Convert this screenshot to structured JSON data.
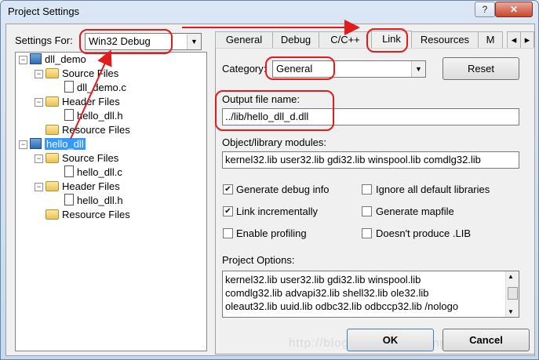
{
  "window": {
    "title": "Project Settings",
    "help_label": "?",
    "close_label": "✕"
  },
  "settings_for": {
    "label": "Settings For:",
    "value": "Win32 Debug"
  },
  "tree": {
    "nodes": [
      {
        "label": "dll_demo"
      },
      {
        "label": "Source Files"
      },
      {
        "label": "dll_demo.c"
      },
      {
        "label": "Header Files"
      },
      {
        "label": "hello_dll.h"
      },
      {
        "label": "Resource Files"
      },
      {
        "label": "hello_dll"
      },
      {
        "label": "Source Files"
      },
      {
        "label": "hello_dll.c"
      },
      {
        "label": "Header Files"
      },
      {
        "label": "hello_dll.h"
      },
      {
        "label": "Resource Files"
      }
    ]
  },
  "tabs": [
    {
      "label": "General"
    },
    {
      "label": "Debug"
    },
    {
      "label": "C/C++"
    },
    {
      "label": "Link"
    },
    {
      "label": "Resources"
    },
    {
      "label": "M"
    }
  ],
  "tab_scroll": {
    "left": "◂",
    "right": "▸"
  },
  "link": {
    "category_label": "Category:",
    "category_value": "General",
    "reset_label": "Reset",
    "output_label": "Output file name:",
    "output_value": "../lib/hello_dll_d.dll",
    "modules_label": "Object/library modules:",
    "modules_value": "kernel32.lib user32.lib gdi32.lib winspool.lib comdlg32.lib",
    "options": [
      {
        "label": "Generate debug info",
        "checked": true
      },
      {
        "label": "Ignore all default libraries",
        "checked": false
      },
      {
        "label": "Link incrementally",
        "checked": true
      },
      {
        "label": "Generate mapfile",
        "checked": false
      },
      {
        "label": "Enable profiling",
        "checked": false
      },
      {
        "label": "Doesn't produce .LIB",
        "checked": false
      }
    ],
    "project_options_label": "Project Options:",
    "project_options_lines": [
      "kernel32.lib user32.lib gdi32.lib winspool.lib",
      "comdlg32.lib advapi32.lib shell32.lib ole32.lib",
      "oleaut32.lib uuid.lib odbc32.lib odbccp32.lib /nologo"
    ]
  },
  "buttons": {
    "ok": "OK",
    "cancel": "Cancel"
  },
  "watermark": "http://blog.csdn.net/ss/unplus",
  "colors": {
    "annotation": "#e21b1b",
    "selection": "#3399ff"
  }
}
